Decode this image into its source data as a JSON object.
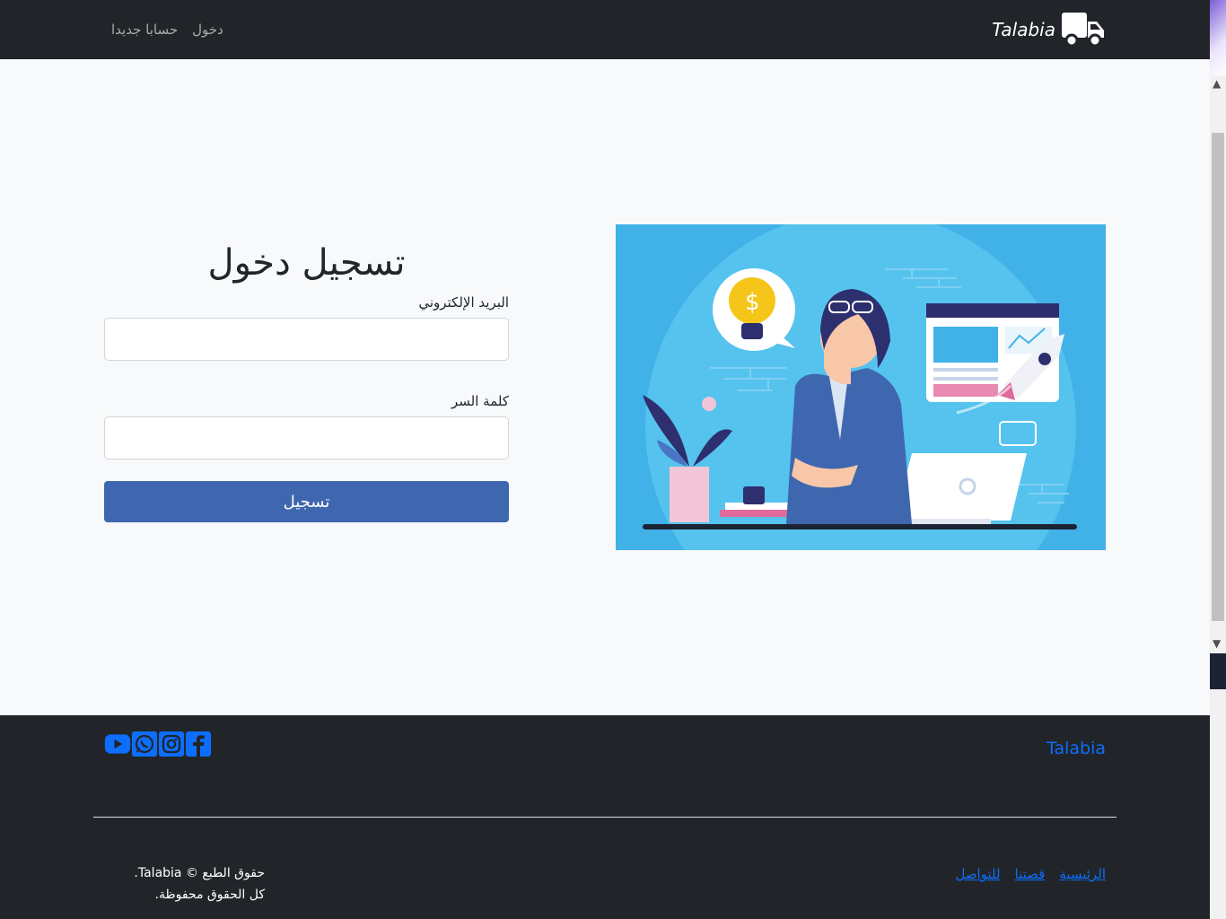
{
  "navbar": {
    "brand": "Talabia",
    "brand_icon": "truck-icon",
    "links": [
      "دخول",
      "حسابا جديدا"
    ]
  },
  "login": {
    "title": "تسجيل دخول",
    "email_label": "البريد الإلكتروني",
    "email_value": "",
    "password_label": "كلمة السر",
    "password_value": "",
    "submit_label": "تسجيل"
  },
  "footer": {
    "brand": "Talabia",
    "social_icons": [
      "facebook-icon",
      "instagram-icon",
      "whatsapp-icon",
      "youtube-icon"
    ],
    "links": [
      "الرئيسية",
      "قصتنا",
      "للتواصل"
    ],
    "copyright_line1": "حقوق الطبع © Talabia.",
    "copyright_line2": "كل الحقوق محفوظة."
  },
  "colors": {
    "navbar_bg": "#212529",
    "accent_button": "#3f67af",
    "link_blue": "#0d6efd",
    "illustration_bg": "#40b2e8"
  }
}
